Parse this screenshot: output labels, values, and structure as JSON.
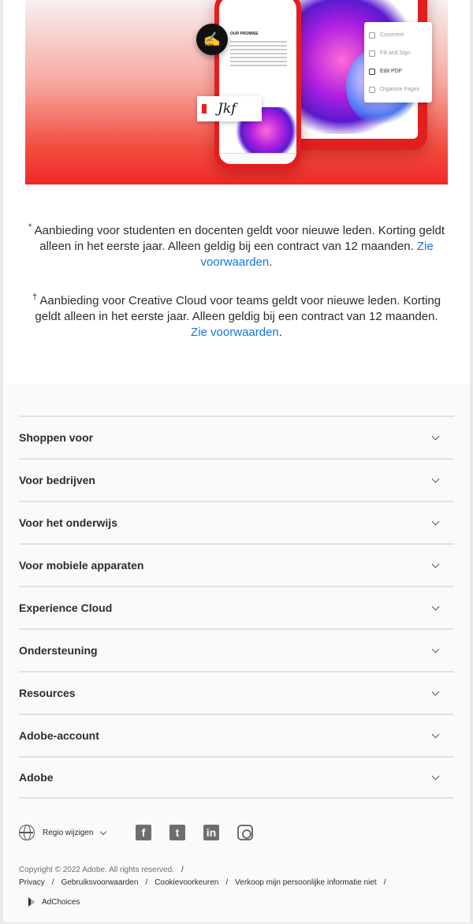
{
  "hero": {
    "phone_heading": "OUR PROMISE",
    "signature_text": "Jkf",
    "side_menu": [
      "Comment",
      "Fill and Sign",
      "Edit PDF",
      "Organize Pages"
    ]
  },
  "notes": {
    "students": {
      "marker": "*",
      "text": "Aanbieding voor studenten en docenten geldt voor nieuwe leden. Korting geldt alleen in het eerste jaar. Alleen geldig bij een contract van 12 maanden.",
      "link": "Zie voorwaarden"
    },
    "teams": {
      "marker": "†",
      "text": "Aanbieding voor Creative Cloud voor teams geldt voor nieuwe leden. Korting geldt alleen in het eerste jaar. Alleen geldig bij een contract van 12 maanden.",
      "link": "Zie voorwaarden"
    }
  },
  "footer": {
    "sections": [
      "Shoppen voor",
      "Voor bedrijven",
      "Voor het onderwijs",
      "Voor mobiele apparaten",
      "Experience Cloud",
      "Ondersteuning",
      "Resources",
      "Adobe-account",
      "Adobe"
    ],
    "region_label": "Regio wijzigen",
    "social": [
      "facebook-icon",
      "twitter-icon",
      "linkedin-icon",
      "instagram-icon"
    ],
    "copyright": "Copyright © 2022 Adobe. All rights reserved.",
    "links": [
      "Privacy",
      "Gebruiksvoorwaarden",
      "Cookievoorkeuren",
      "Verkoop mijn persoonlijke informatie niet"
    ],
    "adchoices": "AdChoices"
  }
}
